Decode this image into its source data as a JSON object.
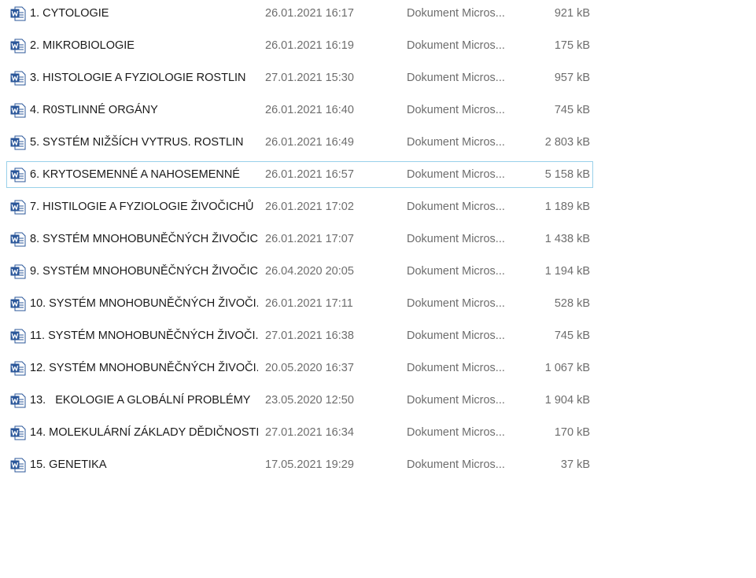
{
  "file_list": {
    "icon": "word-document-icon",
    "selected_index": 5,
    "rows": [
      {
        "name": "1. CYTOLOGIE",
        "date": "26.01.2021 16:17",
        "type": "Dokument Micros...",
        "size": "921 kB"
      },
      {
        "name": "2. MIKROBIOLOGIE",
        "date": "26.01.2021 16:19",
        "type": "Dokument Micros...",
        "size": "175 kB"
      },
      {
        "name": "3. HISTOLOGIE A FYZIOLOGIE ROSTLIN",
        "date": "27.01.2021 15:30",
        "type": "Dokument Micros...",
        "size": "957 kB"
      },
      {
        "name": "4. R0STLINNÉ ORGÁNY",
        "date": "26.01.2021 16:40",
        "type": "Dokument Micros...",
        "size": "745 kB"
      },
      {
        "name": "5. SYSTÉM NIŽŠÍCH VYTRUS. ROSTLIN",
        "date": "26.01.2021 16:49",
        "type": "Dokument Micros...",
        "size": "2 803 kB"
      },
      {
        "name": "6. KRYTOSEMENNÉ A NAHOSEMENNÉ",
        "date": "26.01.2021 16:57",
        "type": "Dokument Micros...",
        "size": "5 158 kB"
      },
      {
        "name": "7. HISTILOGIE A FYZIOLOGIE ŽIVOČICHŮ",
        "date": "26.01.2021 17:02",
        "type": "Dokument Micros...",
        "size": "1 189 kB"
      },
      {
        "name": "8. SYSTÉM MNOHOBUNĚČNÝCH ŽIVOČIC...",
        "date": "26.01.2021 17:07",
        "type": "Dokument Micros...",
        "size": "1 438 kB"
      },
      {
        "name": "9. SYSTÉM MNOHOBUNĚČNÝCH ŽIVOČIC...",
        "date": "26.04.2020 20:05",
        "type": "Dokument Micros...",
        "size": "1 194 kB"
      },
      {
        "name": "10. SYSTÉM MNOHOBUNĚČNÝCH ŽIVOČI...",
        "date": "26.01.2021 17:11",
        "type": "Dokument Micros...",
        "size": "528 kB"
      },
      {
        "name": "11. SYSTÉM MNOHOBUNĚČNÝCH ŽIVOČI...",
        "date": "27.01.2021 16:38",
        "type": "Dokument Micros...",
        "size": "745 kB"
      },
      {
        "name": "12. SYSTÉM MNOHOBUNĚČNÝCH ŽIVOČI...",
        "date": "20.05.2020 16:37",
        "type": "Dokument Micros...",
        "size": "1 067 kB"
      },
      {
        "name": "13.   EKOLOGIE A GLOBÁLNÍ PROBLÉMY",
        "date": "23.05.2020 12:50",
        "type": "Dokument Micros...",
        "size": "1 904 kB"
      },
      {
        "name": "14. MOLEKULÁRNÍ ZÁKLADY DĚDIČNOSTI",
        "date": "27.01.2021 16:34",
        "type": "Dokument Micros...",
        "size": "170 kB"
      },
      {
        "name": "15. GENETIKA",
        "date": "17.05.2021 19:29",
        "type": "Dokument Micros...",
        "size": "37 kB"
      }
    ]
  },
  "colors": {
    "selection_border": "#99d1ea",
    "word_icon_blue": "#2b579a",
    "secondary_text": "#6d6d6d"
  }
}
